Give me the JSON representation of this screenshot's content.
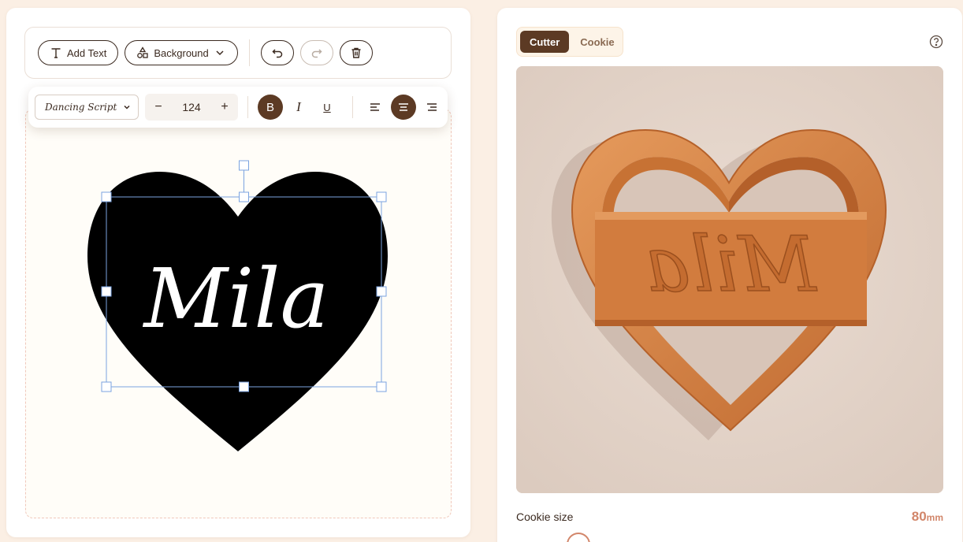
{
  "toolbar": {
    "add_text_label": "Add Text",
    "background_label": "Background"
  },
  "format": {
    "font_value": "Dancing Script",
    "font_size": "124",
    "bold_label": "B",
    "italic_label": "I",
    "underline_label": "U",
    "align_active": "center"
  },
  "editor": {
    "text": "Mila",
    "heart_color": "#000000",
    "text_color": "#ffffff"
  },
  "preview": {
    "tabs": [
      {
        "label": "Cutter",
        "active": true
      },
      {
        "label": "Cookie",
        "active": false
      }
    ],
    "model_text": "Mila",
    "cutter_color": "#d07a3e"
  },
  "cookie_size": {
    "label": "Cookie size",
    "value": "80",
    "unit": "mm"
  },
  "icons": [
    "text-icon",
    "shapes-icon",
    "chevron-down-icon",
    "undo-icon",
    "redo-icon",
    "trash-icon",
    "align-left-icon",
    "align-center-icon",
    "align-right-icon",
    "help-icon"
  ],
  "colors": {
    "accent": "#5c3a24",
    "highlight": "#d2866a",
    "selection": "#7ba3e0"
  }
}
